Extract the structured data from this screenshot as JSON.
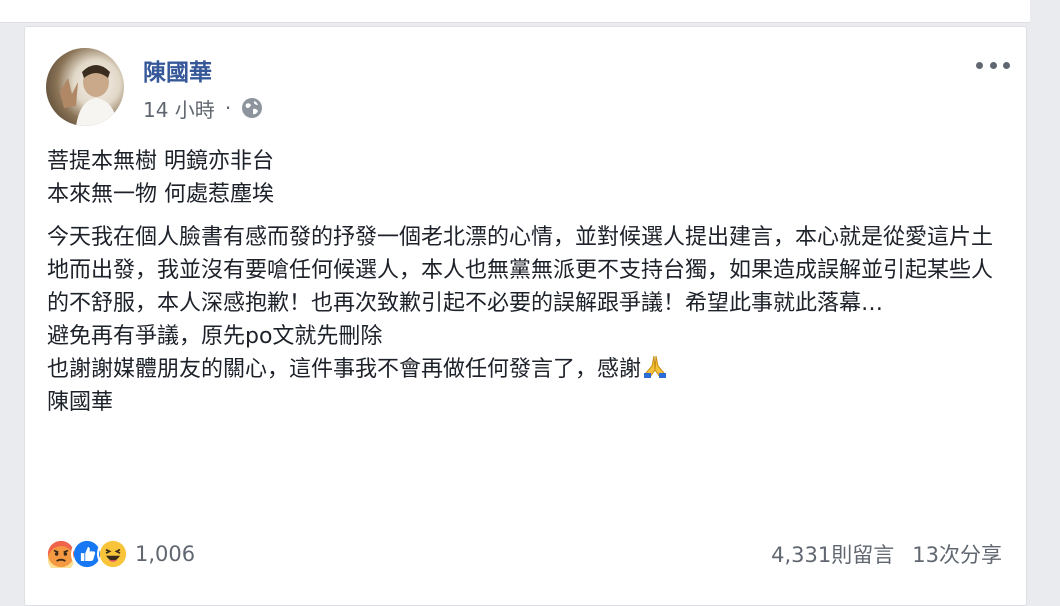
{
  "post": {
    "author": "陳國華",
    "time": "14 小時",
    "separator": "·",
    "privacy_icon": "globe-icon",
    "more_icon": "more-options-icon",
    "lines_group1": [
      "菩提本無樹 明鏡亦非台",
      "本來無一物 何處惹塵埃"
    ],
    "paragraph": "今天我在個人臉書有感而發的抒發一個老北漂的心情，並對候選人提出建言，本心就是從愛這片土地而出發，我並沒有要嗆任何候選人，本人也無黨無派更不支持台獨，如果造成誤解並引起某些人的不舒服，本人深感抱歉！也再次致歉引起不必要的誤解跟爭議！希望此事就此落幕…",
    "line_delete": "避免再有爭議，原先po文就先刪除",
    "line_thanks": "也謝謝媒體朋友的關心，這件事我不會再做任何發言了，感謝",
    "thanks_emoji": "folded-hands-emoji",
    "signature": "陳國華"
  },
  "reactions": {
    "icons": [
      "angry-reaction-icon",
      "like-reaction-icon",
      "haha-reaction-icon"
    ],
    "count": "1,006"
  },
  "stats": {
    "comments": "4,331則留言",
    "shares": "13次分享"
  },
  "colors": {
    "link": "#365899",
    "secondary": "#616770",
    "like": "#1877f2",
    "angry": "#f0644b",
    "haha": "#f7c43a"
  }
}
